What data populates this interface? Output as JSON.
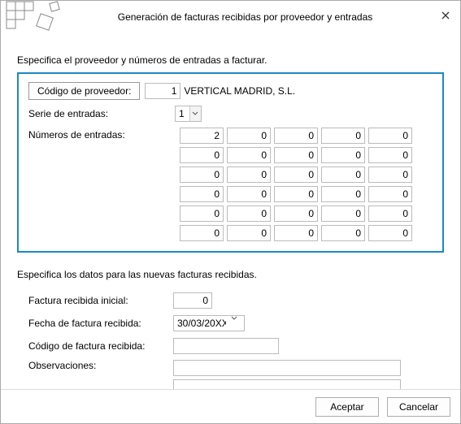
{
  "window": {
    "title": "Generación de facturas recibidas por proveedor y entradas"
  },
  "instr1": "Especifica el proveedor y números de entradas a facturar.",
  "provider": {
    "code_button_label": "Código de proveedor:",
    "code_value": "1",
    "name": "VERTICAL MADRID, S.L."
  },
  "serie": {
    "label": "Serie de entradas:",
    "value": "1"
  },
  "entries": {
    "label": "Números de entradas:",
    "rows": [
      [
        "2",
        "0",
        "0",
        "0",
        "0"
      ],
      [
        "0",
        "0",
        "0",
        "0",
        "0"
      ],
      [
        "0",
        "0",
        "0",
        "0",
        "0"
      ],
      [
        "0",
        "0",
        "0",
        "0",
        "0"
      ],
      [
        "0",
        "0",
        "0",
        "0",
        "0"
      ],
      [
        "0",
        "0",
        "0",
        "0",
        "0"
      ]
    ]
  },
  "instr2": "Especifica los datos para las nuevas facturas recibidas.",
  "new_invoice": {
    "initial_label": "Factura recibida inicial:",
    "initial_value": "0",
    "date_label": "Fecha de factura recibida:",
    "date_value": "30/03/20XX",
    "code_label": "Código de factura recibida:",
    "code_value": "",
    "obs_label": "Observaciones:",
    "obs_value1": "",
    "obs_value2": ""
  },
  "footer": {
    "ok": "Aceptar",
    "cancel": "Cancelar"
  }
}
